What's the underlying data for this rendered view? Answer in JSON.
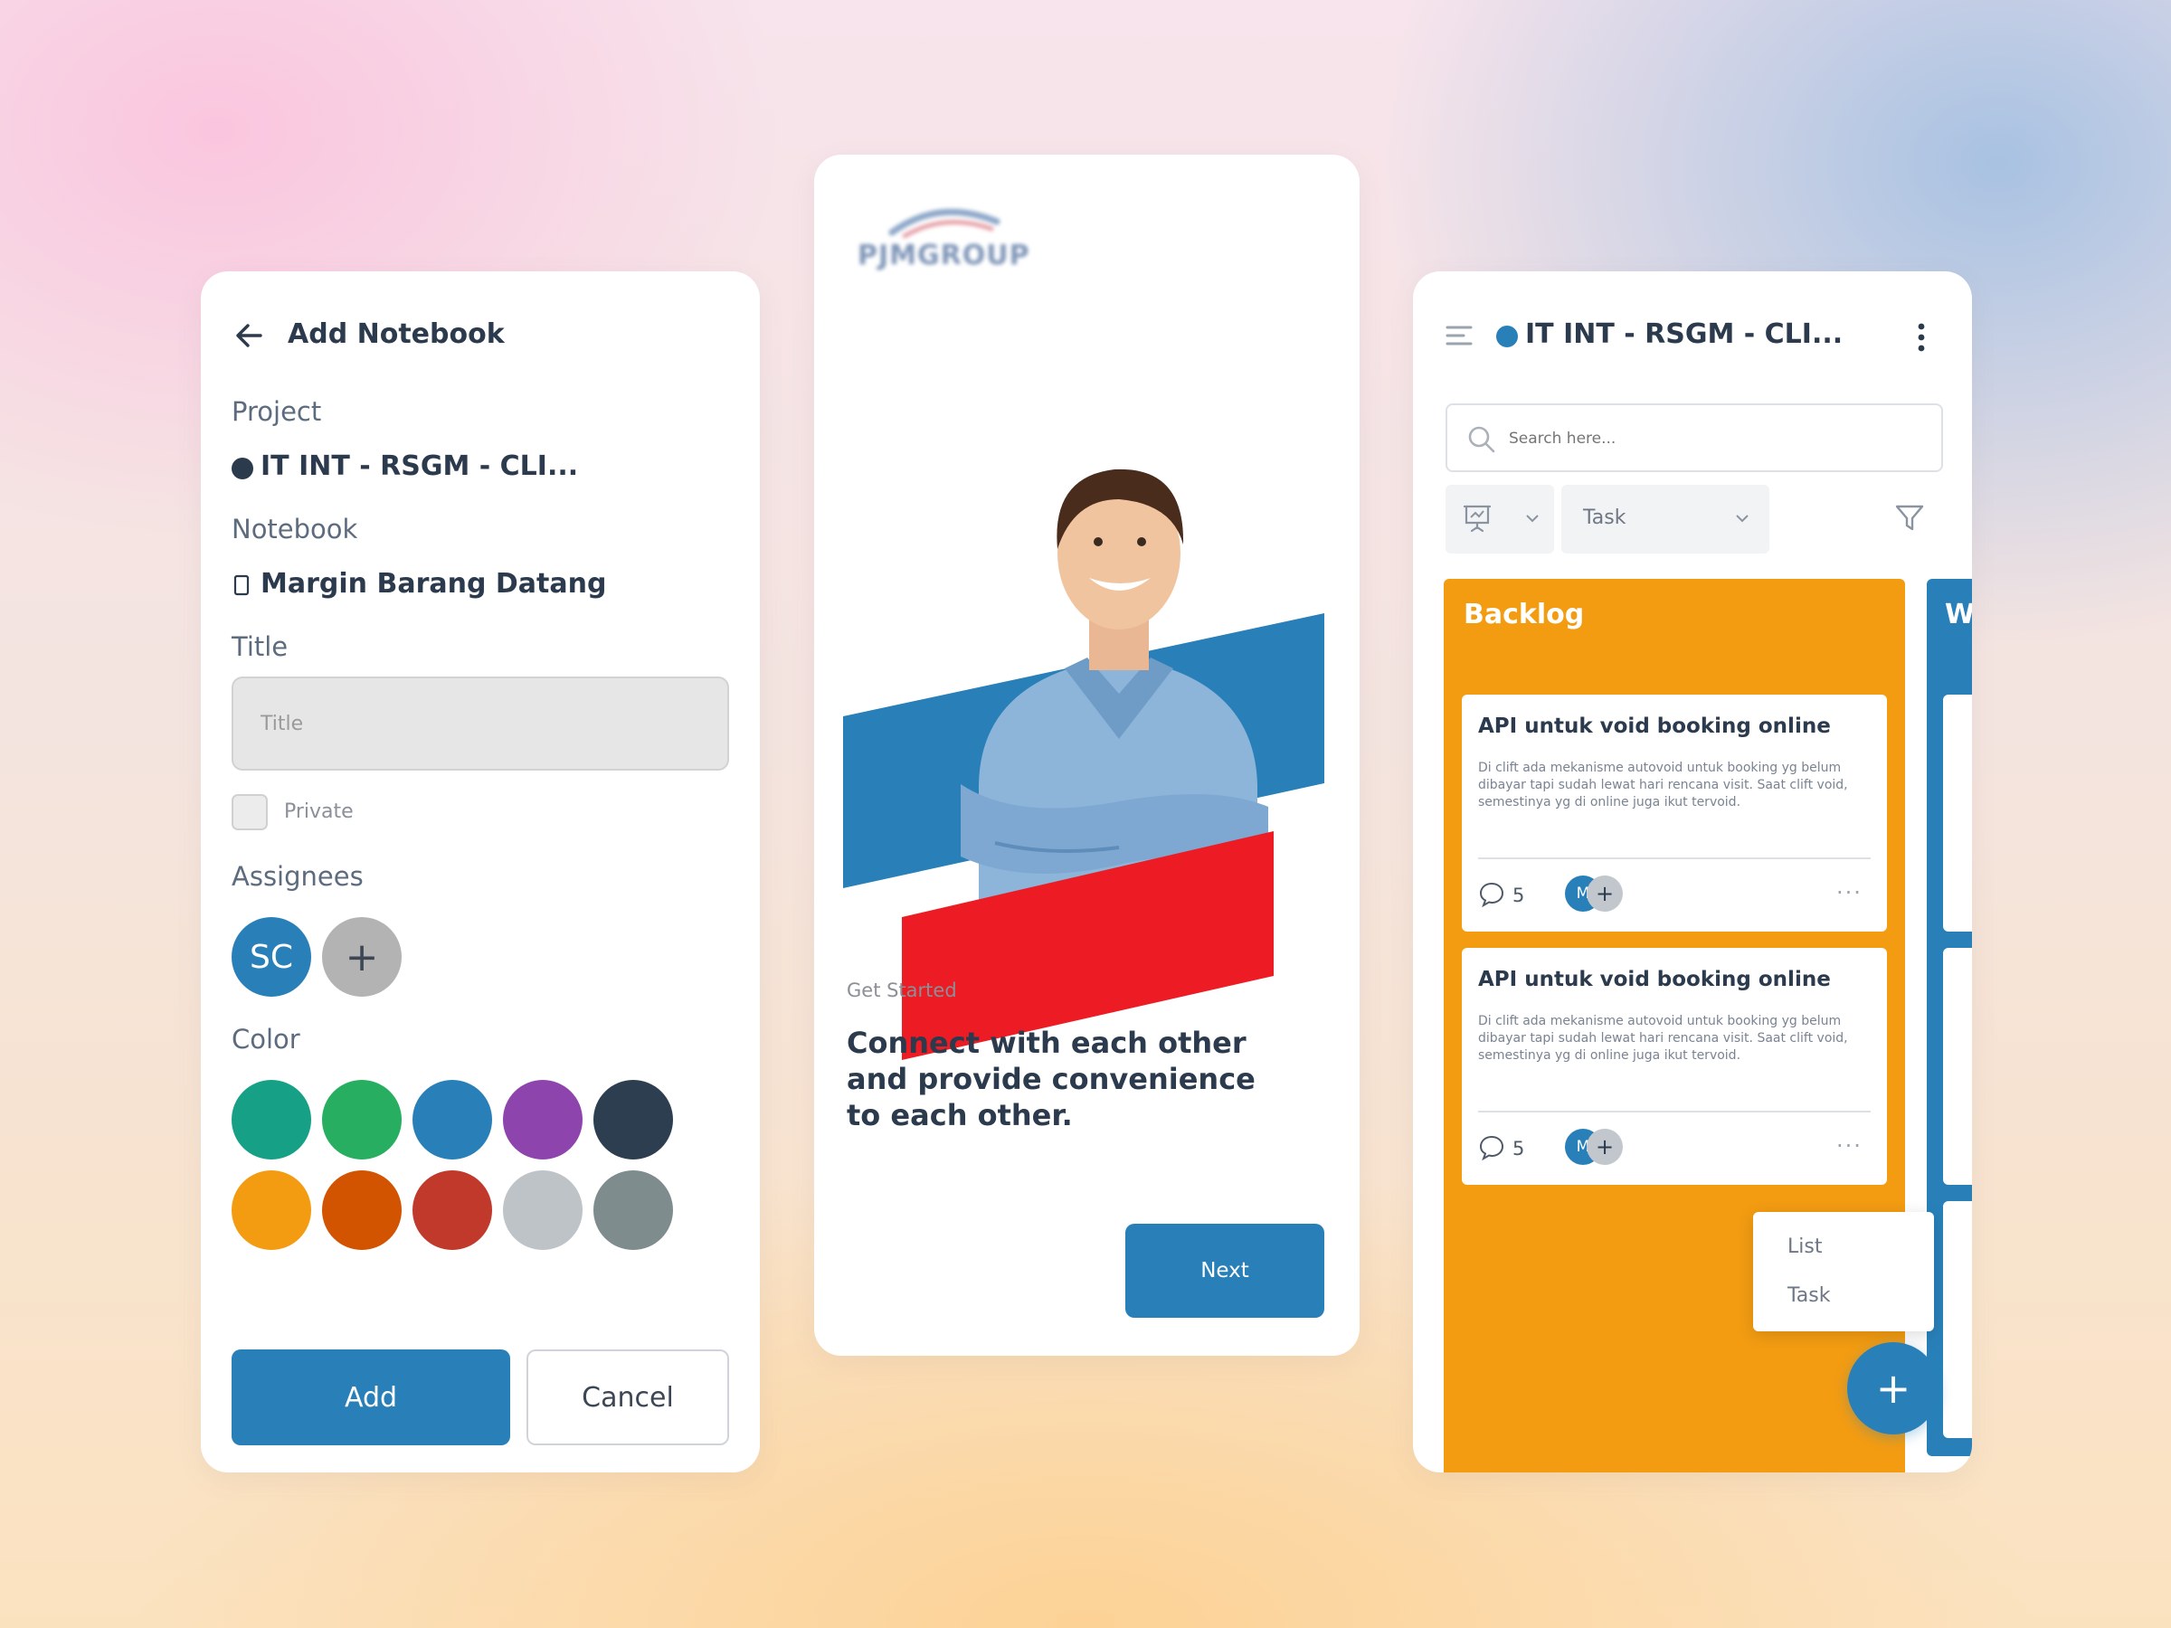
{
  "add_notebook": {
    "title": "Add Notebook",
    "project_label": "Project",
    "project_value": "IT INT - RSGM - CLI...",
    "notebook_label": "Notebook",
    "notebook_value": "Margin Barang Datang",
    "title_label": "Title",
    "title_placeholder": "Title",
    "private_label": "Private",
    "assignees_label": "Assignees",
    "assignee_initials": "SC",
    "add_assignee": "+",
    "color_label": "Color",
    "colors": [
      "#16a085",
      "#27ae60",
      "#2980b9",
      "#8e44ad",
      "#2c3e50",
      "#f39c12",
      "#d35400",
      "#c0392b",
      "#bdc3c7",
      "#7f8c8d"
    ],
    "add_button": "Add",
    "cancel_button": "Cancel"
  },
  "onboarding": {
    "logo_text": "PJMGROUP",
    "eyebrow": "Get Started",
    "headline": [
      "Connect with each other",
      "and provide convenience",
      "to each other."
    ],
    "next_button": "Next",
    "accent_blue": "#2980b9",
    "accent_red": "#ed1c24"
  },
  "board": {
    "project_title": "IT INT - RSGM - CLI...",
    "search_placeholder": "Search here...",
    "view_select": "Task",
    "columns": [
      {
        "name": "Backlog"
      },
      {
        "name": "W"
      }
    ],
    "cards": [
      {
        "title": "API untuk void booking online",
        "description": "Di clift ada mekanisme autovoid untuk booking yg belum dibayar tapi sudah lewat hari rencana visit. Saat clift void, semestinya yg di online juga ikut tervoid.",
        "comments": "5",
        "avatar": "M",
        "add": "+",
        "more": "..."
      },
      {
        "title": "API untuk void booking online",
        "description": "Di clift ada mekanisme autovoid untuk booking yg belum dibayar tapi sudah lewat hari rencana visit. Saat clift void, semestinya yg di online juga ikut tervoid.",
        "comments": "5",
        "avatar": "M",
        "add": "+",
        "more": "..."
      }
    ],
    "menu": [
      "List",
      "Task"
    ],
    "fab": "+",
    "backlog_color": "#f39c12",
    "primary_color": "#2980b9"
  }
}
